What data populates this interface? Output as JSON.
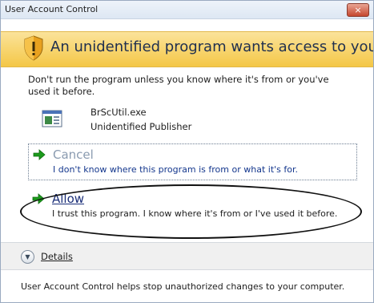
{
  "window": {
    "title": "User Account Control",
    "close_label": "×"
  },
  "banner": {
    "heading": "An unidentified program wants access to your computer",
    "icon": "shield-warning-icon"
  },
  "warning": {
    "text": "Don't run the program unless you know where it's from or you've used it before."
  },
  "program": {
    "name": "BrScUtil.exe",
    "publisher": "Unidentified Publisher",
    "icon": "program-icon"
  },
  "options": {
    "cancel": {
      "title": "Cancel",
      "description": "I don't know where this program is from or what it's for.",
      "icon": "green-arrow-icon"
    },
    "allow": {
      "title": "Allow",
      "description": "I trust this program. I know where it's from or I've used it before.",
      "icon": "green-arrow-icon"
    }
  },
  "details": {
    "label": "Details",
    "icon": "chevron-down-icon"
  },
  "footer": {
    "text": "User Account Control helps stop unauthorized changes to your computer."
  },
  "colors": {
    "banner": "#f4c746",
    "link_blue": "#1b2f79",
    "arrow_green": "#1c9b1c"
  }
}
